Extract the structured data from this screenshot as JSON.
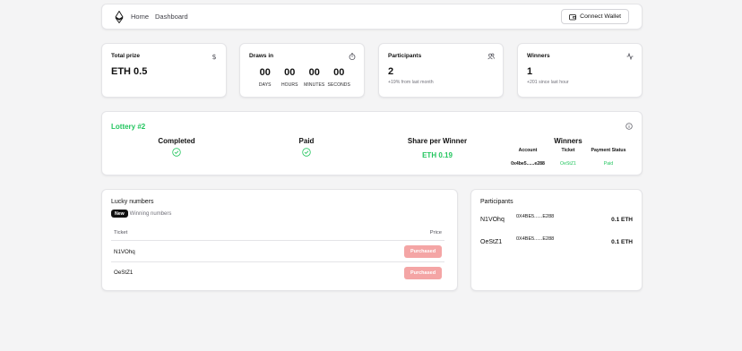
{
  "header": {
    "nav": [
      "Home",
      "Dashboard"
    ],
    "connect_label": "Connect Wallet",
    "icons": {
      "logo": "ethereum-icon",
      "wallet": "wallet-icon"
    }
  },
  "stats": {
    "total_prize": {
      "title": "Total prize",
      "value": "ETH 0.5",
      "icon": "dollar-icon"
    },
    "draws_in": {
      "title": "Draws in",
      "icon": "timer-icon",
      "units": [
        {
          "value": "00",
          "label": "DAYS"
        },
        {
          "value": "00",
          "label": "HOURS"
        },
        {
          "value": "00",
          "label": "MINUTES"
        },
        {
          "value": "00",
          "label": "SECONDS"
        }
      ]
    },
    "participants": {
      "title": "Participants",
      "value": "2",
      "sub": "+19% from last month",
      "icon": "users-icon"
    },
    "winners": {
      "title": "Winners",
      "value": "1",
      "sub": "+201 since last hour",
      "icon": "activity-icon"
    }
  },
  "lottery": {
    "title": "Lottery #2",
    "status_label": "Completed",
    "paid_label": "Paid",
    "share_label": "Share per Winner",
    "share_value": "ETH 0.19",
    "winners_label": "Winners",
    "winners_table": {
      "headers": [
        "Account",
        "Ticket",
        "Payment Status"
      ],
      "rows": [
        {
          "account": "0x4be5......e288",
          "ticket": "OeStZ1",
          "status": "Paid"
        }
      ]
    }
  },
  "lucky": {
    "title": "Lucky numbers",
    "badge": "New",
    "badge_text": "Winning numbers",
    "columns": [
      "Ticket",
      "Price"
    ],
    "rows": [
      {
        "ticket": "N1VOhq",
        "action": "Purchased"
      },
      {
        "ticket": "OeStZ1",
        "action": "Purchased"
      }
    ]
  },
  "participants_panel": {
    "title": "Participants",
    "rows": [
      {
        "name": "N1VOhq",
        "address": "0X4BE5......E288",
        "amount": "0.1 ETH"
      },
      {
        "name": "OeStZ1",
        "address": "0X4BE5......E288",
        "amount": "0.1 ETH"
      }
    ]
  },
  "colors": {
    "accent_green": "#22c55e",
    "purchased_btn": "#f4a5a5"
  }
}
